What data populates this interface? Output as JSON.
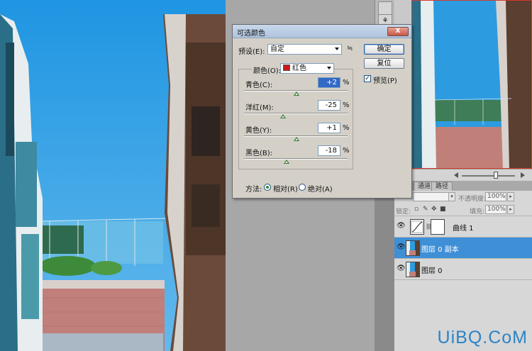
{
  "dialog": {
    "title": "可选颜色",
    "close_label": "X",
    "preset_label": "预设(E):",
    "preset_value": "自定",
    "ok_label": "确定",
    "reset_label": "复位",
    "preview_label": "预览(P)",
    "preview_checked": true,
    "colors_label": "颜色(O):",
    "colors_value": "红色",
    "colors_swatch": "#cc1a1a",
    "sliders": [
      {
        "label": "青色(C):",
        "value": "+2",
        "percent": 2
      },
      {
        "label": "洋红(M):",
        "value": "-25",
        "percent": -25
      },
      {
        "label": "黄色(Y):",
        "value": "+1",
        "percent": 1
      },
      {
        "label": "黑色(B):",
        "value": "-18",
        "percent": -18
      }
    ],
    "percent_sign": "%",
    "method_label": "方法:",
    "method_options": [
      {
        "label": "相对(R)",
        "selected": true
      },
      {
        "label": "绝对(A)",
        "selected": false
      }
    ]
  },
  "layers_panel": {
    "tabs": [
      "通道",
      "路径"
    ],
    "opacity_label": "不透明度:",
    "opacity_value": "100%",
    "lock_label": "锁定:",
    "fill_label": "填充:",
    "fill_value": "100%",
    "layers": [
      {
        "name": "曲线 1",
        "selected": false,
        "kind": "adjustment"
      },
      {
        "name": "图层 0 副本",
        "selected": true,
        "kind": "image"
      },
      {
        "name": "图层 0",
        "selected": false,
        "kind": "image"
      }
    ]
  },
  "watermark": "UiBQ.CoM",
  "icons": {
    "eye": "eye-icon",
    "preset_options": "preset-options-icon",
    "lock": "lock-icon",
    "chain": "chain-link-icon"
  }
}
